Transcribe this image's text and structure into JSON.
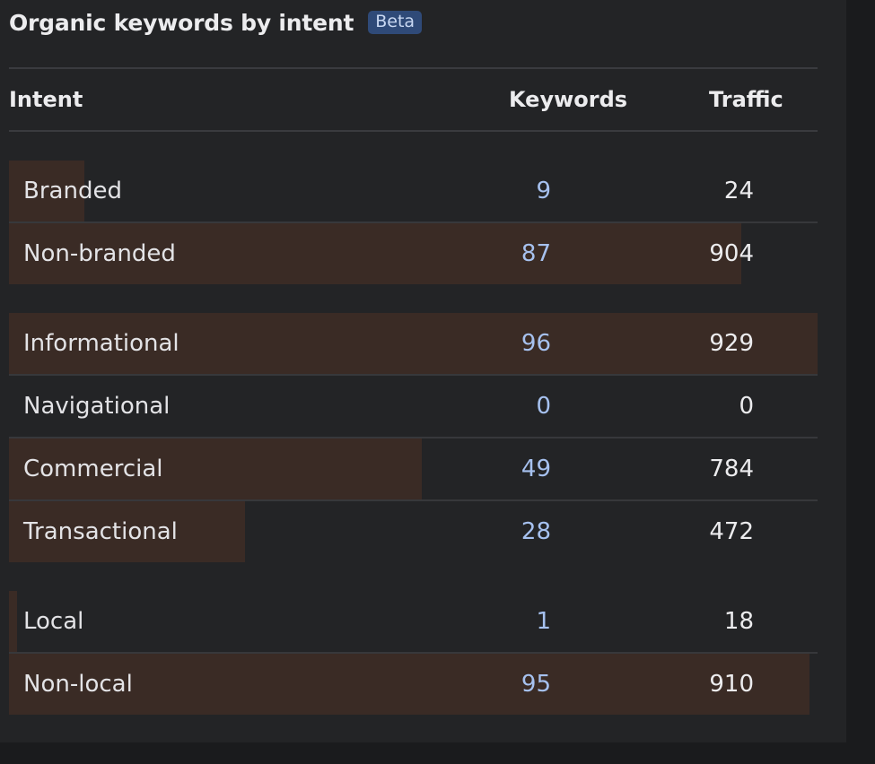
{
  "widget": {
    "title": "Organic keywords by intent",
    "badge": "Beta"
  },
  "columns": {
    "intent": "Intent",
    "keywords": "Keywords",
    "traffic": "Traffic"
  },
  "groups": [
    {
      "rows": [
        {
          "label": "Branded",
          "keywords": "9",
          "traffic": "24",
          "share": 0.093
        },
        {
          "label": "Non-branded",
          "keywords": "87",
          "traffic": "904",
          "share": 0.906
        }
      ]
    },
    {
      "rows": [
        {
          "label": "Informational",
          "keywords": "96",
          "traffic": "929",
          "share": 1.0
        },
        {
          "label": "Navigational",
          "keywords": "0",
          "traffic": "0",
          "share": 0.0
        },
        {
          "label": "Commercial",
          "keywords": "49",
          "traffic": "784",
          "share": 0.51
        },
        {
          "label": "Transactional",
          "keywords": "28",
          "traffic": "472",
          "share": 0.292
        }
      ]
    },
    {
      "rows": [
        {
          "label": "Local",
          "keywords": "1",
          "traffic": "18",
          "share": 0.01
        },
        {
          "label": "Non-local",
          "keywords": "95",
          "traffic": "910",
          "share": 0.99
        }
      ]
    }
  ]
}
